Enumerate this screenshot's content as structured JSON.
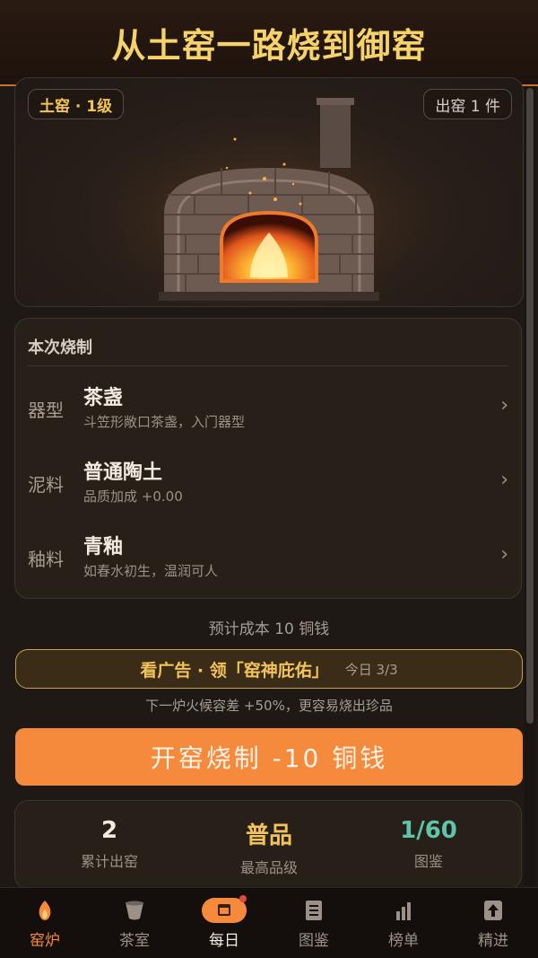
{
  "banner": {
    "title": "从土窑一路烧到御窑"
  },
  "kiln": {
    "level_badge": "土窑 · 1级",
    "output_badge": "出窑 1 件"
  },
  "craft": {
    "header": "本次烧制",
    "rows": [
      {
        "label": "器型",
        "name": "茶盏",
        "desc": "斗笠形敞口茶盏，入门器型"
      },
      {
        "label": "泥料",
        "name": "普通陶土",
        "desc": "品质加成 +0.00"
      },
      {
        "label": "釉料",
        "name": "青釉",
        "desc": "如春水初生，温润可人"
      }
    ],
    "chevron": "›"
  },
  "cost_text": "预计成本 10 铜钱",
  "ad": {
    "label": "看广告 · 领「窑神庇佑」",
    "count": "今日 3/3",
    "subtitle": "下一炉火候容差 +50%，更容易烧出珍品"
  },
  "fire_button": {
    "label": "开窑烧制  -10 铜钱"
  },
  "stats": [
    {
      "value": "2",
      "label": "累计出窑",
      "color": "#f3ebe2"
    },
    {
      "value": "普品",
      "label": "最高品级",
      "color": "#f2c35a"
    },
    {
      "value": "1/60",
      "label": "图鉴",
      "color": "#5fc4a8"
    }
  ],
  "tabs": [
    {
      "label": "窑炉",
      "icon": "flame-icon",
      "active": true
    },
    {
      "label": "茶室",
      "icon": "tea-cup-icon",
      "active": false
    },
    {
      "label": "每日",
      "icon": "calendar-icon",
      "active": false,
      "badge": true
    },
    {
      "label": "图鉴",
      "icon": "catalog-icon",
      "active": false
    },
    {
      "label": "榜单",
      "icon": "bar-chart-icon",
      "active": false
    },
    {
      "label": "精进",
      "icon": "upgrade-icon",
      "active": false
    }
  ],
  "colors": {
    "accent": "#f58a3c",
    "gold": "#f2c35a",
    "teal": "#5fc4a8",
    "background": "#1f1916"
  }
}
